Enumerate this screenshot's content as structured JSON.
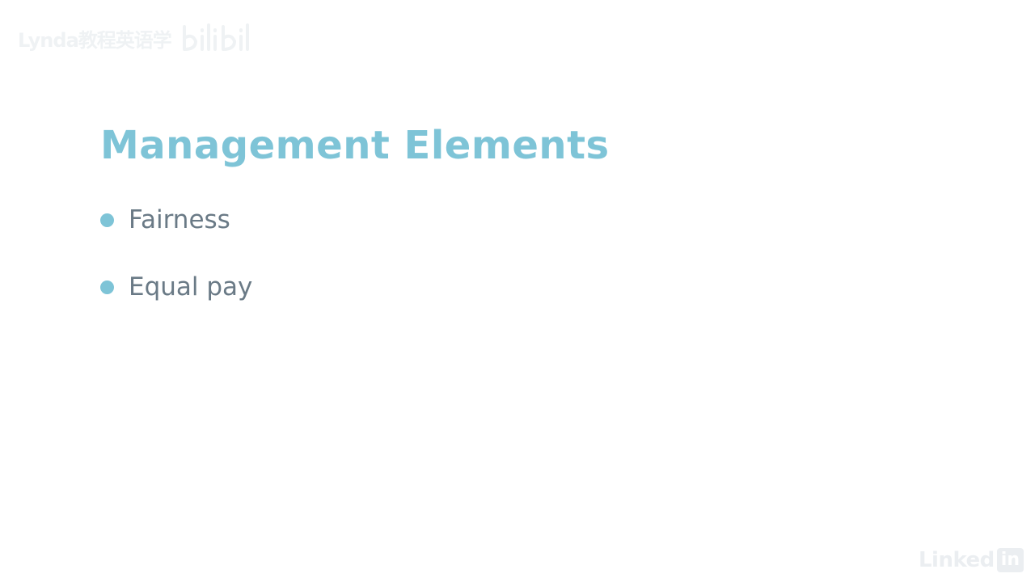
{
  "watermark": {
    "text": "Lynda教程英语学",
    "bili_icon": "bilibili-logo-icon"
  },
  "slide": {
    "title": "Management Elements",
    "bullets": [
      {
        "label": "Fairness"
      },
      {
        "label": "Equal pay"
      }
    ]
  },
  "logo": {
    "text": "Linked",
    "box": "in"
  },
  "colors": {
    "title": "#7ec4d7",
    "bullet_dot": "#7ec4d7",
    "bullet_text": "#6a7a86",
    "background": "#ffffff",
    "watermark": "#e9edf0"
  }
}
